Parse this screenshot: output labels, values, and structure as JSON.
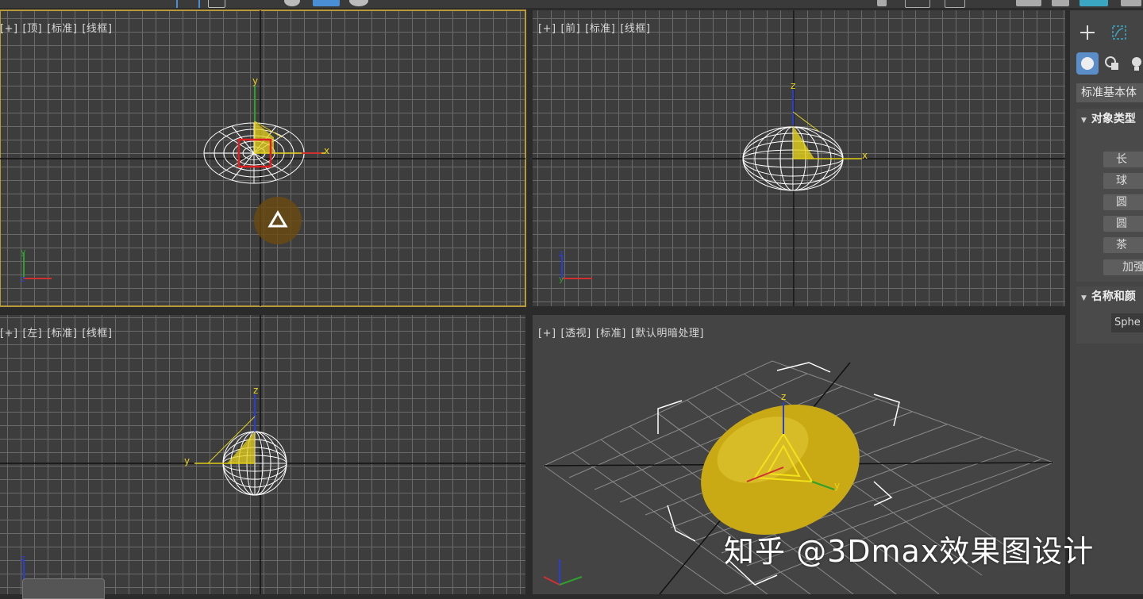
{
  "viewports": {
    "top": {
      "labels": [
        "[+]",
        "[顶]",
        "[标准]",
        "[线框]"
      ],
      "axis_x": "x",
      "axis_y": "y",
      "corner_axis": [
        "y",
        "z"
      ]
    },
    "front": {
      "labels": [
        "[+]",
        "[前]",
        "[标准]",
        "[线框]"
      ],
      "axis_x": "x",
      "axis_z": "z",
      "corner_axis": [
        "z",
        "y"
      ]
    },
    "left": {
      "labels": [
        "[+]",
        "[左]",
        "[标准]",
        "[线框]"
      ],
      "axis_y": "y",
      "axis_z": "z",
      "corner_axis": [
        "z"
      ]
    },
    "perspective": {
      "labels": [
        "[+]",
        "[透视]",
        "[标准]",
        "[默认明暗处理]"
      ],
      "axis_z": "z",
      "axis_y": "y",
      "object_color": "#c9a914"
    }
  },
  "command_panel": {
    "create_icon": "plus-icon",
    "modify_icon": "modify-icon",
    "geometry_icon": "sphere-icon",
    "shapes_icon": "shapes-icon",
    "lights_icon": "light-icon",
    "dropdown": "标准基本体",
    "rollout_object_type": "对象类型",
    "object_type_buttons": [
      "长",
      "球",
      "圆",
      "圆",
      "茶",
      "加强"
    ],
    "rollout_name_color": "名称和颜",
    "name_value": "Sphe"
  },
  "watermark": "知乎 @3Dmax效果图设计",
  "colors": {
    "selection_border": "#b89a3a",
    "gizmo_yellow": "#e6d21c",
    "axis_x": "#d03030",
    "axis_y": "#2ea02e",
    "axis_z": "#2a3fd0",
    "panel_bg": "#444444",
    "active_tab": "#5b8ec9"
  }
}
